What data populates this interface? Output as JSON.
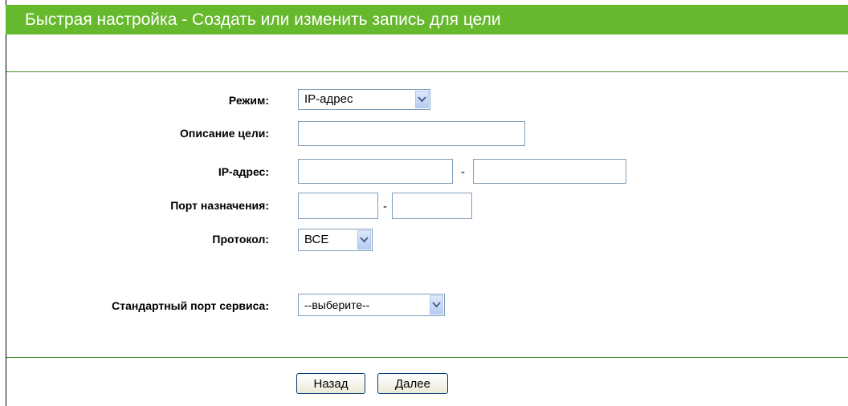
{
  "header": {
    "title": "Быстрая настройка - Создать или изменить запись для цели"
  },
  "form": {
    "mode": {
      "label": "Режим:",
      "value": "IP-адрес"
    },
    "description": {
      "label": "Описание цели:",
      "value": ""
    },
    "ip": {
      "label": "IP-адрес:",
      "from": "",
      "separator": "-",
      "to": ""
    },
    "port": {
      "label": "Порт назначения:",
      "from": "",
      "separator": "-",
      "to": ""
    },
    "protocol": {
      "label": "Протокол:",
      "value": "ВСЕ"
    },
    "service": {
      "label": "Стандартный порт сервиса:",
      "value": "--выберите--"
    }
  },
  "buttons": {
    "back": "Назад",
    "next": "Далее"
  },
  "colors": {
    "accent": "#66b82c",
    "divider": "#3f8f2a",
    "input_border": "#7f9db9"
  },
  "icons": {
    "dropdown": "chevron-down-icon"
  }
}
